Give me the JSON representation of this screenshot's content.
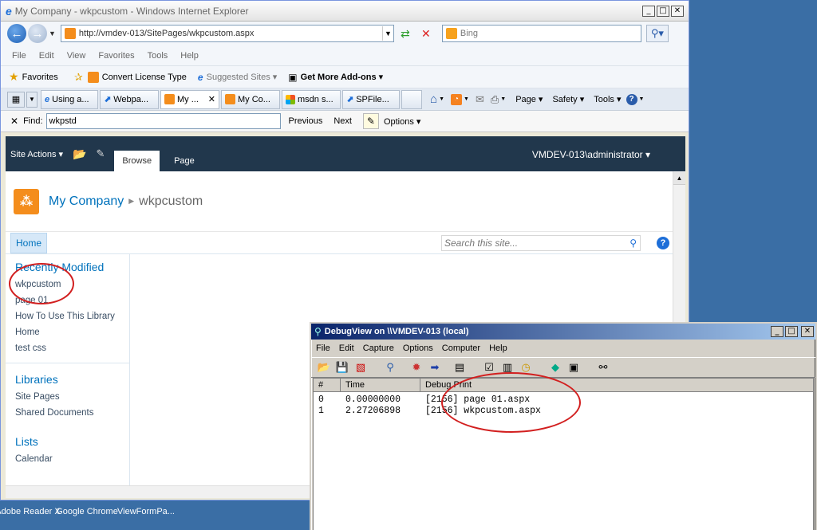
{
  "ie": {
    "title": "My Company - wkpcustom - Windows Internet Explorer",
    "address": "http://vmdev-013/SitePages/wkpcustom.aspx",
    "search_placeholder": "Bing",
    "menu": [
      "File",
      "Edit",
      "View",
      "Favorites",
      "Tools",
      "Help"
    ],
    "favorites_label": "Favorites",
    "fav_links": [
      "Convert License Type",
      "Suggested Sites ▾",
      "Get More Add-ons ▾"
    ],
    "tabs": [
      "Using a...",
      "Webpa...",
      "My ...",
      "My Co...",
      "msdn s...",
      "SPFile..."
    ],
    "commands": [
      "Page ▾",
      "Safety ▾",
      "Tools ▾"
    ],
    "find_label": "Find:",
    "find_value": "wkpstd",
    "find_prev": "Previous",
    "find_next": "Next",
    "find_options": "Options ▾"
  },
  "sharepoint": {
    "site_actions": "Site Actions ▾",
    "ribbon_tabs": [
      "Browse",
      "Page"
    ],
    "user": "VMDEV-013\\administrator ▾",
    "site_name": "My Company",
    "page_name": "wkpcustom",
    "home_tab": "Home",
    "search_placeholder": "Search this site...",
    "recently_modified": {
      "heading": "Recently Modified",
      "items": [
        "wkpcustom",
        "page 01",
        "How To Use This Library",
        "Home",
        "test css"
      ]
    },
    "libraries": {
      "heading": "Libraries",
      "items": [
        "Site Pages",
        "Shared Documents"
      ]
    },
    "lists": {
      "heading": "Lists",
      "items": [
        "Calendar"
      ]
    }
  },
  "debugview": {
    "title": "DebugView on \\\\VMDEV-013 (local)",
    "menu": [
      "File",
      "Edit",
      "Capture",
      "Options",
      "Computer",
      "Help"
    ],
    "columns": [
      "#",
      "Time",
      "Debug Print"
    ],
    "rows": [
      {
        "num": "0",
        "time": "0.00000000",
        "text": "[2156] page 01.aspx"
      },
      {
        "num": "1",
        "time": "2.27206898",
        "text": "[2156] wkpcustom.aspx"
      }
    ]
  },
  "desktop": {
    "icons": [
      "Adobe Reader X",
      "Google Chrome",
      "ViewFormPa..."
    ]
  },
  "colors": {
    "ribbon": "#21374c",
    "link": "#0072bc",
    "highlight": "#d21f1f",
    "desktop": "#3a6ea5"
  }
}
